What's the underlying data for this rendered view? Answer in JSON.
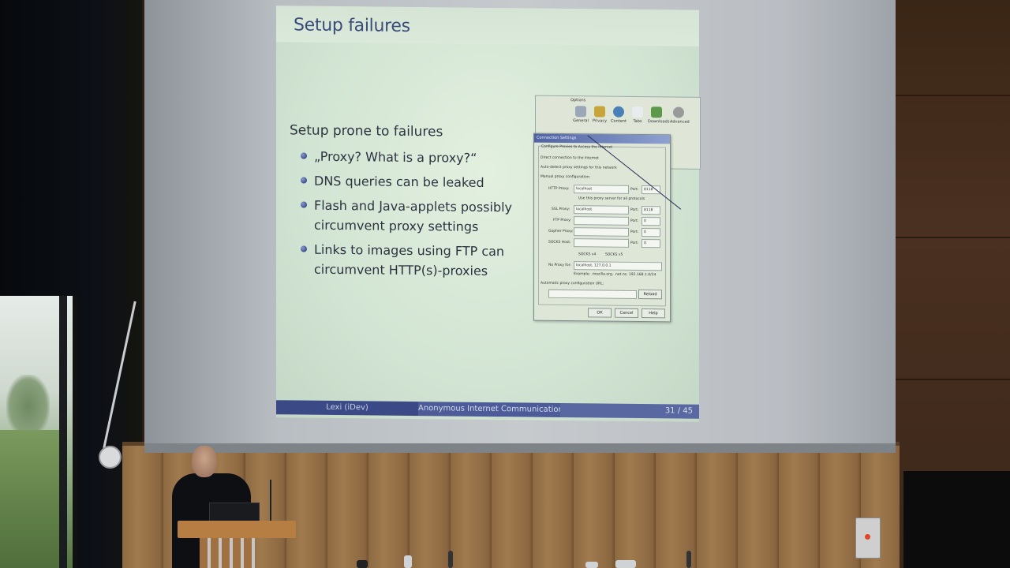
{
  "slide": {
    "title": "Setup failures",
    "lead": "Setup prone to failures",
    "bullets": [
      "„Proxy? What is a proxy?“",
      "DNS queries can be leaked",
      "Flash and Java-applets possibly circumvent proxy settings",
      "Links to images using FTP can circumvent HTTP(s)-proxies"
    ],
    "footer": {
      "author": "Lexi (iDev)",
      "talk": "Anonymous Internet Communication Don",
      "page": "31 / 45"
    }
  },
  "dialog_screenshot": {
    "window_title": "Options",
    "toolbar": [
      "General",
      "Privacy",
      "Content",
      "Tabs",
      "Downloads",
      "Advanced"
    ],
    "dialog_title": "Connection Settings",
    "group_label": "Configure Proxies to Access the Internet",
    "options": [
      "Direct connection to the Internet",
      "Auto-detect proxy settings for this network",
      "Manual proxy configuration:"
    ],
    "rows": [
      {
        "label": "HTTP Proxy:",
        "value": "localhost",
        "port_label": "Port:",
        "port": "8118"
      },
      {
        "label": "SSL Proxy:",
        "value": "localhost",
        "port_label": "Port:",
        "port": "8118"
      },
      {
        "label": "FTP Proxy:",
        "value": "",
        "port_label": "Port:",
        "port": "0"
      },
      {
        "label": "Gopher Proxy:",
        "value": "",
        "port_label": "Port:",
        "port": "0"
      },
      {
        "label": "SOCKS Host:",
        "value": "",
        "port_label": "Port:",
        "port": "0"
      }
    ],
    "same_proxy": "Use this proxy server for all protocols",
    "socks_v4": "SOCKS v4",
    "socks_v5": "SOCKS v5",
    "no_proxy_label": "No Proxy for:",
    "no_proxy_value": "localhost, 127.0.0.1",
    "example": "Example: .mozilla.org, .net.nz, 192.168.1.0/24",
    "auto_url": "Automatic proxy configuration URL:",
    "reload": "Reload",
    "buttons": [
      "OK",
      "Cancel",
      "Help"
    ]
  }
}
